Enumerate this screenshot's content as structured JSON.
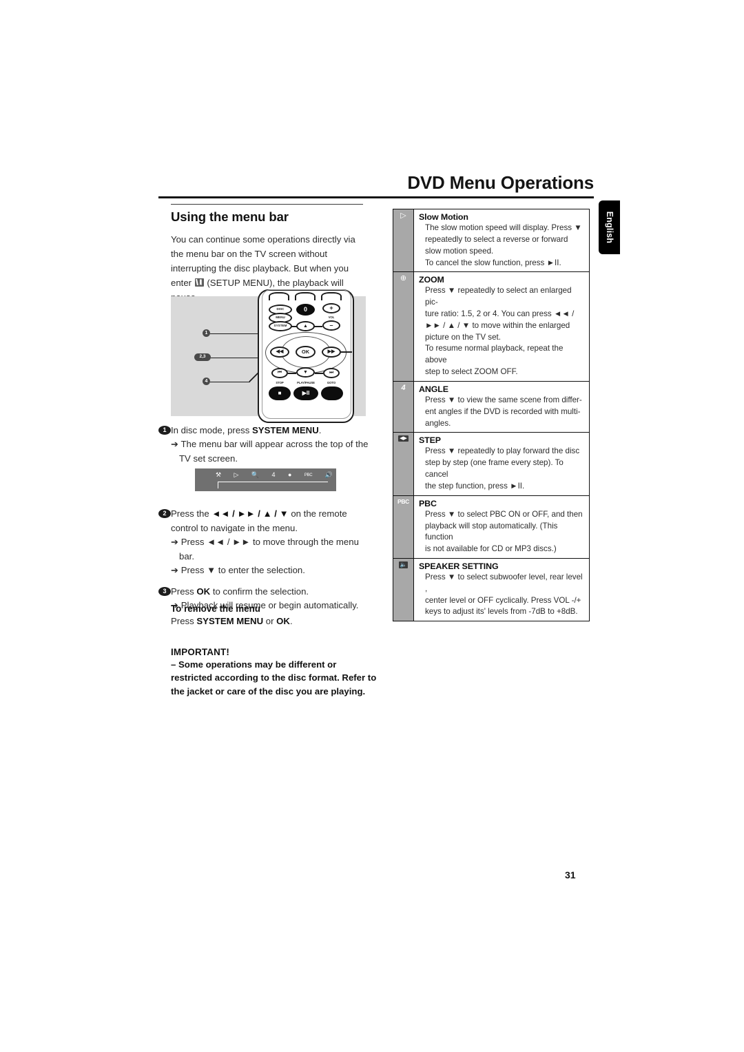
{
  "header": {
    "title": "DVD Menu Operations",
    "language_tab": "English"
  },
  "left_column": {
    "section_heading": "Using the menu bar",
    "intro_part1": "You can continue some operations directly via the menu bar on the TV screen without interrupting the disc playback. But when you enter",
    "intro_icon": "setup-menu-icon",
    "intro_part2": "(SETUP MENU), the playback will pause.",
    "remote_figure": {
      "name": "remote-control-diagram",
      "callouts": [
        "1",
        "2,3",
        "4"
      ],
      "buttons": [
        {
          "name": "disc-menu-system-button",
          "label": "DISC MENU SYSTEM"
        },
        {
          "name": "zero-button",
          "label": "0"
        },
        {
          "name": "vol-up-button",
          "label": "+"
        },
        {
          "name": "vol-label",
          "label": "VOL"
        },
        {
          "name": "vol-down-button",
          "label": "–"
        },
        {
          "name": "up-button",
          "label": "▲"
        },
        {
          "name": "rewind-button",
          "label": "◄◄"
        },
        {
          "name": "ok-button",
          "label": "OK"
        },
        {
          "name": "forward-button",
          "label": "►►"
        },
        {
          "name": "previous-button",
          "label": "⏮"
        },
        {
          "name": "down-button",
          "label": "▼"
        },
        {
          "name": "next-button",
          "label": "⏭"
        },
        {
          "name": "stop-label",
          "label": "STOP"
        },
        {
          "name": "play-pause-label",
          "label": "PLAY/PAUSE"
        },
        {
          "name": "goto-label",
          "label": "GOTO"
        },
        {
          "name": "stop-button",
          "label": "■"
        },
        {
          "name": "play-pause-button",
          "label": "►II"
        },
        {
          "name": "goto-button",
          "label": ""
        }
      ]
    },
    "steps": [
      {
        "num": "1",
        "main_pre": "In disc mode, press ",
        "main_bold": "SYSTEM MENU",
        "main_post": ".",
        "subs": [
          "➔ The menu bar will appear across the top of the TV set screen."
        ]
      },
      {
        "num": "2",
        "main_pre": "Press the ",
        "main_bold": "◄◄ / ►► / ▲ / ▼",
        "main_post": " on the remote control to navigate in the menu.",
        "subs": [
          "➔ Press ◄◄ / ►► to move through the menu bar.",
          "➔ Press ▼ to enter the selection."
        ]
      },
      {
        "num": "3",
        "main_pre": "Press ",
        "main_bold": "OK",
        "main_post": " to confirm the selection.",
        "subs": [
          "➔ Playback will resume or begin automatically."
        ]
      }
    ],
    "tv_menubar": {
      "name": "tv-screen-menu-bar",
      "icons": [
        "setup-menu-icon",
        "slow-motion-icon",
        "zoom-icon",
        "angle-icon",
        "step-icon",
        "pbc-icon",
        "speaker-setting-icon"
      ],
      "icon_glyphs": [
        "⚒",
        "▷",
        "🔍",
        "4",
        "●",
        "PBC",
        "🔊"
      ]
    },
    "remove_menu": {
      "heading": "To remove the menu",
      "text_pre": "Press ",
      "text_bold1": "SYSTEM MENU",
      "text_mid": " or ",
      "text_bold2": "OK",
      "text_post": "."
    },
    "important": {
      "heading": "IMPORTANT!",
      "body": "–   Some operations may be different or restricted according to the disc format. Refer to the jacket or care of the disc you are playing."
    }
  },
  "function_table": {
    "name": "menu-bar-function-table",
    "rows": [
      {
        "icon": "slow-motion-icon",
        "icon_glyph": "▷",
        "title": "Slow Motion",
        "title_style": "mixed",
        "lines": [
          "The slow motion speed will display. Press ▼",
          "repeatedly to select a reverse or forward",
          "slow motion speed.",
          "To cancel the slow function, press ►II."
        ]
      },
      {
        "icon": "zoom-icon",
        "icon_glyph": "⊕",
        "title": "ZOOM",
        "title_style": "caps",
        "lines": [
          "Press ▼ repeatedly to select an enlarged pic-",
          "ture ratio: 1.5, 2 or 4.  You can press ◄◄ /",
          "►► / ▲ / ▼ to move within the enlarged",
          "picture on the TV set.",
          "To resume normal playback, repeat the above",
          "step to select ZOOM OFF."
        ]
      },
      {
        "icon": "angle-icon",
        "icon_glyph": "4",
        "title": "ANGLE",
        "title_style": "caps",
        "lines": [
          "Press ▼ to view the same scene from differ-",
          "ent angles  if the DVD is recorded with multi-",
          "angles."
        ]
      },
      {
        "icon": "step-icon",
        "icon_glyph": "◀▶",
        "title": "STEP",
        "title_style": "caps",
        "lines": [
          "Press ▼ repeatedly to play forward the disc",
          "step by step (one frame every step). To cancel",
          "the step function, press ►II."
        ]
      },
      {
        "icon": "pbc-icon",
        "icon_glyph": "PBC",
        "title": "PBC",
        "title_style": "caps",
        "lines": [
          "Press ▼ to select PBC ON or OFF, and then",
          "playback will stop automatically. (This function",
          "is not available for CD or MP3 discs.)"
        ]
      },
      {
        "icon": "speaker-setting-icon",
        "icon_glyph": "🔈",
        "title": "SPEAKER SETTING",
        "title_style": "caps",
        "lines": [
          "Press ▼ to select subwoofer level, rear level ,",
          "center level or OFF cyclically.  Press VOL -/+",
          "keys to adjust its' levels from -7dB to +8dB."
        ]
      }
    ]
  },
  "footer": {
    "page_number": "31"
  }
}
